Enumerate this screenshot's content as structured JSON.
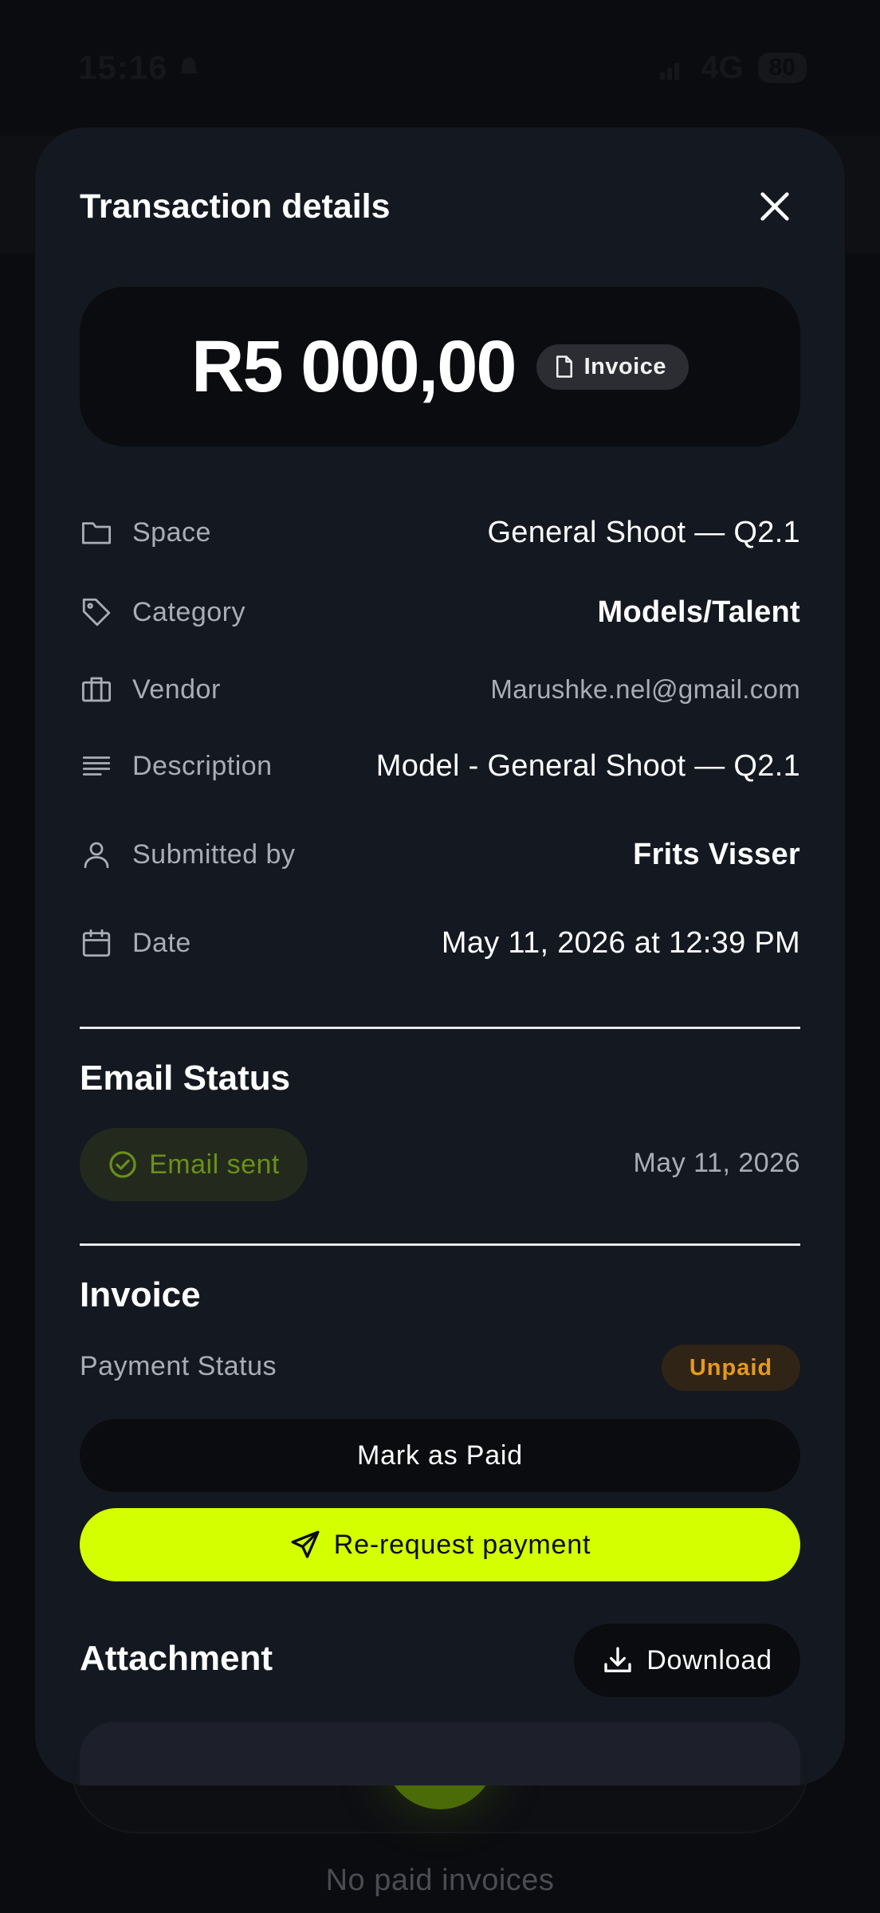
{
  "status_bar": {
    "time": "15:16",
    "network": "4G",
    "battery": "80"
  },
  "background": {
    "empty_message": "No paid invoices"
  },
  "sheet": {
    "title": "Transaction details",
    "amount": "R5 000,00",
    "type_badge": "Invoice",
    "details": [
      {
        "icon": "folder-icon",
        "label": "Space",
        "value": "General Shoot — Q2.1"
      },
      {
        "icon": "tag-icon",
        "label": "Category",
        "value": "Models/Talent"
      },
      {
        "icon": "briefcase-icon",
        "label": "Vendor",
        "value": "Marushke.nel@gmail.com"
      },
      {
        "icon": "text-lines-icon",
        "label": "Description",
        "value": "Model - General Shoot — Q2.1"
      },
      {
        "icon": "user-icon",
        "label": "Submitted by",
        "value": "Frits Visser"
      },
      {
        "icon": "calendar-icon",
        "label": "Date",
        "value": "May 11, 2026 at 12:39 PM"
      }
    ],
    "email_status": {
      "title": "Email Status",
      "pill": "Email sent",
      "date": "May 11, 2026"
    },
    "invoice": {
      "title": "Invoice",
      "payment_label": "Payment Status",
      "payment_status": "Unpaid",
      "mark_paid": "Mark as Paid",
      "rerequest": "Re-request payment"
    },
    "attachment": {
      "title": "Attachment",
      "download": "Download"
    }
  },
  "colors": {
    "accent": "#d4ff00",
    "sheet_bg": "#141820",
    "unpaid": "#e59a1b",
    "email_sent": "#6b8f1a"
  }
}
